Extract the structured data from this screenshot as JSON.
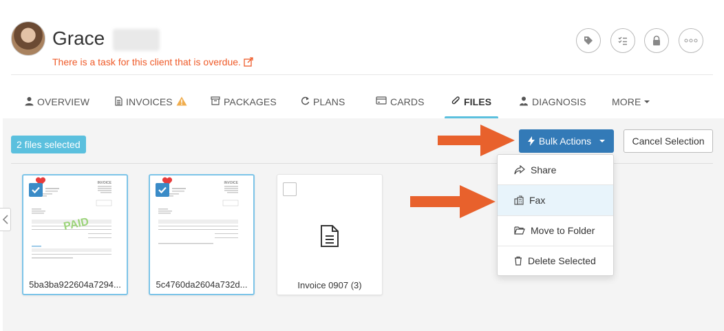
{
  "header": {
    "first_name": "Grace",
    "overdue_notice": "There is a task for this client that is overdue.",
    "overdue_color": "#ef5a28",
    "icons": [
      "tag-icon",
      "checklist-icon",
      "lock-icon",
      "more-options-icon"
    ]
  },
  "tabs": [
    {
      "label": "OVERVIEW",
      "icon": "user-icon"
    },
    {
      "label": "INVOICES",
      "icon": "document-icon",
      "badge": "warning-icon"
    },
    {
      "label": "PACKAGES",
      "icon": "package-icon"
    },
    {
      "label": "PLANS",
      "icon": "refresh-icon"
    },
    {
      "label": "CARDS",
      "icon": "card-icon"
    },
    {
      "label": "FILES",
      "icon": "paperclip-icon",
      "active": true
    },
    {
      "label": "DIAGNOSIS",
      "icon": "diagnosis-icon"
    },
    {
      "label": "MORE",
      "icon": "chevron-down-icon"
    }
  ],
  "files": {
    "selected_count_label": "2 files selected",
    "bulk_actions_label": "Bulk Actions",
    "cancel_selection_label": "Cancel Selection",
    "menu": [
      {
        "label": "Share",
        "icon": "share-icon"
      },
      {
        "label": "Fax",
        "icon": "fax-icon"
      },
      {
        "label": "Move to Folder",
        "icon": "folder-icon"
      },
      {
        "label": "Delete Selected",
        "icon": "trash-icon"
      }
    ],
    "items": [
      {
        "name": "5ba3ba922604a7294...",
        "selected": true,
        "thumb": "invoice-paid"
      },
      {
        "name": "5c4760da2604a732d...",
        "selected": true,
        "thumb": "invoice"
      },
      {
        "name": "Invoice 0907 (3)",
        "selected": false,
        "thumb": "document-icon"
      }
    ],
    "paid_stamp": "PAID",
    "invoice_word": "INVOICE"
  },
  "colors": {
    "accent": "#5bc0de",
    "primary_button": "#337ab7",
    "arrow": "#e8612c",
    "warning": "#f0ad4e"
  }
}
